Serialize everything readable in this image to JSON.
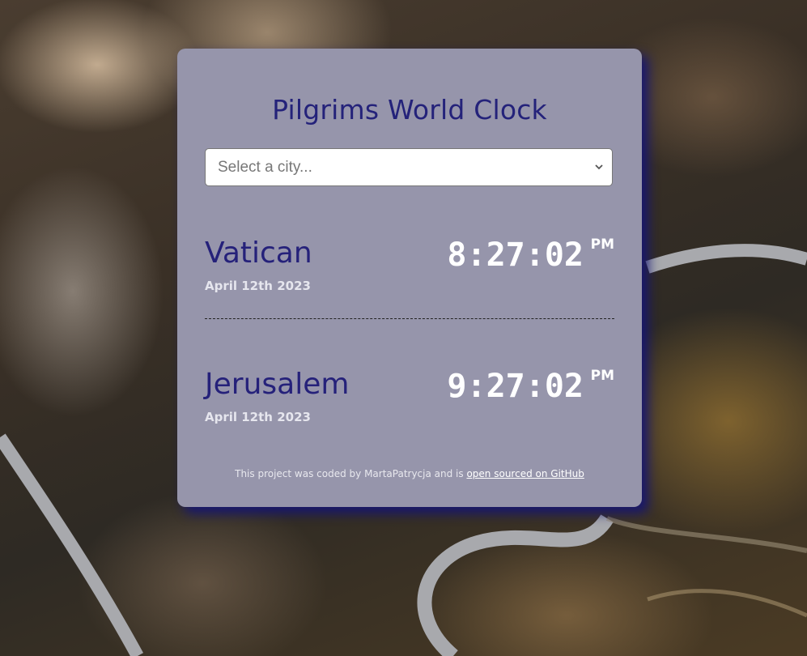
{
  "app": {
    "title": "Pilgrims World Clock"
  },
  "city_select": {
    "placeholder": "Select a city..."
  },
  "cities": [
    {
      "name": "Vatican",
      "date": "April 12th 2023",
      "time": "8:27:02",
      "ampm": "PM"
    },
    {
      "name": "Jerusalem",
      "date": "April 12th 2023",
      "time": "9:27:02",
      "ampm": "PM"
    }
  ],
  "footer": {
    "text": "This project was coded by MartaPatrycja and is",
    "link_text": "open sourced on GitHub"
  },
  "colors": {
    "card_bg": "#9695ab",
    "title": "#24227a",
    "shadow": "#14147a"
  },
  "icons": {
    "select_chevron": "chevron-down-icon"
  }
}
